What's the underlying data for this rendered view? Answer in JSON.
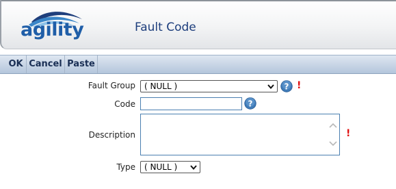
{
  "header": {
    "logo_text": "agility",
    "title": "Fault Code"
  },
  "toolbar": {
    "ok_label": "OK",
    "cancel_label": "Cancel",
    "paste_label": "Paste"
  },
  "form": {
    "fault_group": {
      "label": "Fault Group",
      "value": "( NULL )",
      "required_mark": "!"
    },
    "code": {
      "label": "Code",
      "value": ""
    },
    "description": {
      "label": "Description",
      "value": "",
      "required_mark": "!"
    },
    "type": {
      "label": "Type",
      "value": "( NULL )"
    }
  },
  "colors": {
    "brand_blue": "#1f5ea8",
    "title_blue": "#1c3d7c",
    "toolbar_bg": "#c9d6e6",
    "required_red": "#e01010",
    "help_icon_blue": "#3f7bb8"
  },
  "icons": {
    "help": "question-circle-icon",
    "dropdown": "chevron-down-icon",
    "logo_wave": "wave-logo-icon"
  }
}
